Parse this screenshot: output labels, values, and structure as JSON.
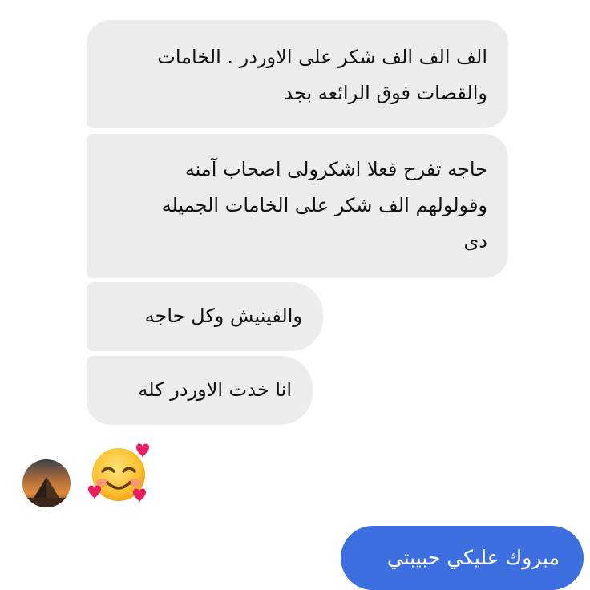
{
  "conversation": {
    "incoming": [
      {
        "lines": [
          "الف الف الف شكر على الاوردر . الخامات",
          "والقصات فوق الرائعه بجد"
        ]
      },
      {
        "lines": [
          "حاجه تفرح فعلا اشكرولى اصحاب آمنه",
          "وقولولهم الف شكر على الخامات الجميله",
          "دى"
        ]
      },
      {
        "lines": [
          "والفينيش وكل حاجه"
        ]
      },
      {
        "lines": [
          "انا خدت الاوردر كله"
        ]
      }
    ],
    "reaction": {
      "icon": "smiling-face-with-hearts-icon"
    },
    "outgoing": {
      "text": "مبروك عليكي حبيبتي"
    }
  },
  "colors": {
    "incoming_bubble": "#ececed",
    "outgoing_bubble": "#3d6fe0",
    "outgoing_text": "#ffffff"
  }
}
